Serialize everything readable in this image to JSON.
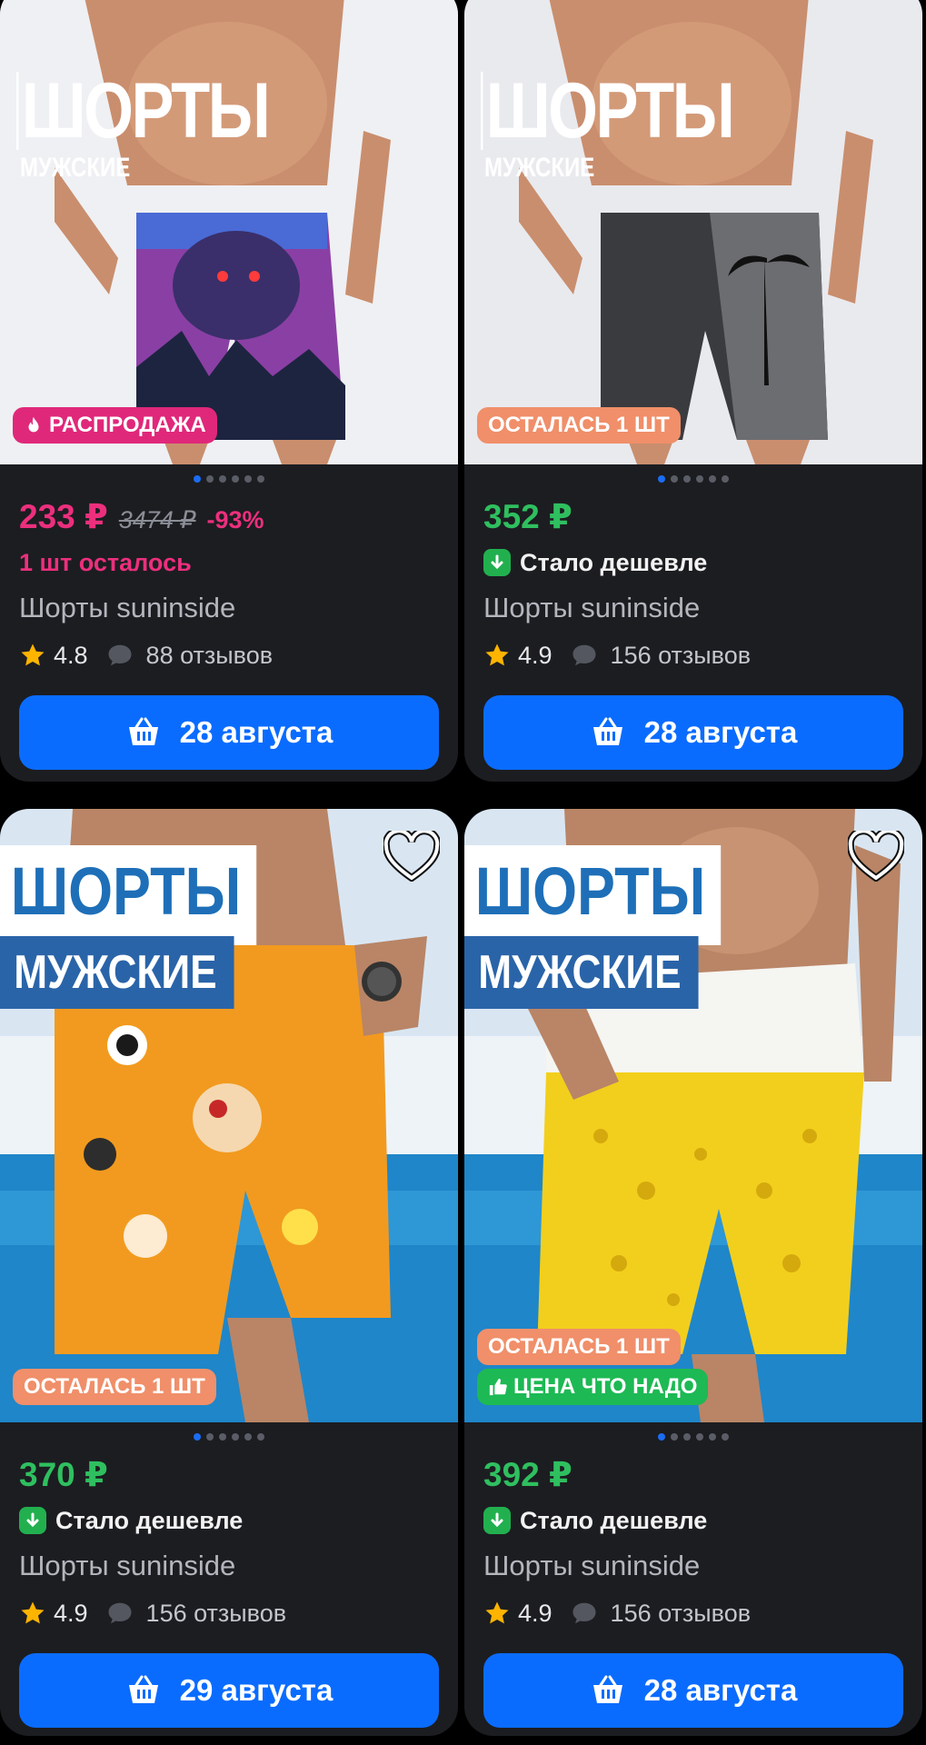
{
  "cards": [
    {
      "overlay_title": "ШОРТЫ",
      "overlay_subtitle": "МУЖСКИЕ",
      "badges": [
        "РАСПРОДАЖА"
      ],
      "price": "233 ₽",
      "old_price": "3474 ₽",
      "discount": "-93%",
      "status": "1 шт осталось",
      "name": "Шорты suninside",
      "rating": "4.8",
      "reviews": "88 отзывов",
      "delivery": "28 августа"
    },
    {
      "overlay_title": "ШОРТЫ",
      "overlay_subtitle": "МУЖСКИЕ",
      "badges": [
        "ОСТАЛАСЬ 1 ШТ"
      ],
      "price": "352 ₽",
      "status": "Стало дешевле",
      "name": "Шорты suninside",
      "rating": "4.9",
      "reviews": "156 отзывов",
      "delivery": "28 августа"
    },
    {
      "overlay_title": "ШОРТЫ",
      "overlay_subtitle": "МУЖСКИЕ",
      "badges": [
        "ОСТАЛАСЬ 1 ШТ"
      ],
      "price": "370 ₽",
      "status": "Стало дешевле",
      "name": "Шорты suninside",
      "rating": "4.9",
      "reviews": "156 отзывов",
      "delivery": "29 августа"
    },
    {
      "overlay_title": "ШОРТЫ",
      "overlay_subtitle": "МУЖСКИЕ",
      "badges": [
        "ОСТАЛАСЬ 1 ШТ",
        "ЦЕНА ЧТО НАДО"
      ],
      "price": "392 ₽",
      "status": "Стало дешевле",
      "name": "Шорты suninside",
      "rating": "4.9",
      "reviews": "156 отзывов",
      "delivery": "28 августа"
    }
  ],
  "colors": {
    "accent_blue": "#0a6cff",
    "price_pink": "#ec2f7d",
    "price_green": "#2fbf5f",
    "card_bg": "#1c1d21"
  },
  "icons": {
    "favorite": "heart-icon",
    "cart": "basket-icon",
    "rating": "star-icon",
    "reviews": "chat-bubble-icon",
    "sale": "fire-icon",
    "price_drop": "arrow-down-icon",
    "good_price": "thumbs-up-icon"
  }
}
